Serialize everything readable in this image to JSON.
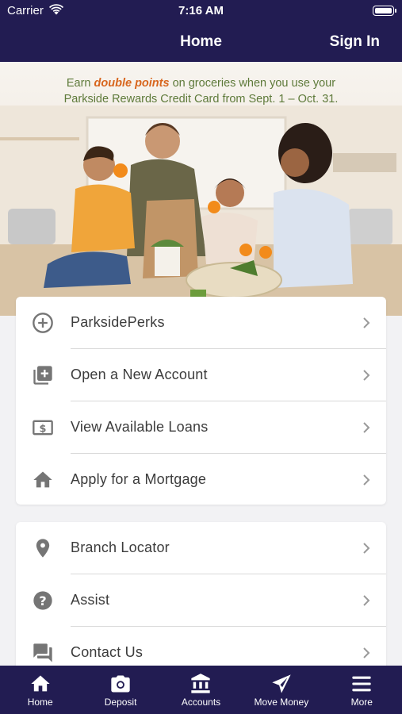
{
  "status_bar": {
    "carrier": "Carrier",
    "time": "7:16 AM"
  },
  "nav": {
    "title": "Home",
    "sign_in": "Sign In"
  },
  "banner": {
    "line1_pre": "Earn ",
    "line1_highlight": "double points",
    "line1_post": " on groceries when you use your",
    "line2": "Parkside Rewards Credit Card from Sept. 1 – Oct. 31."
  },
  "menu_primary": [
    {
      "label": "ParksidePerks",
      "icon": "plus-circle-icon"
    },
    {
      "label": "Open a New Account",
      "icon": "add-box-icon"
    },
    {
      "label": "View Available Loans",
      "icon": "dollar-bill-icon"
    },
    {
      "label": "Apply for a Mortgage",
      "icon": "home-icon"
    }
  ],
  "menu_secondary": [
    {
      "label": "Branch Locator",
      "icon": "location-pin-icon"
    },
    {
      "label": "Assist",
      "icon": "help-icon"
    },
    {
      "label": "Contact Us",
      "icon": "chat-icon"
    }
  ],
  "tabs": [
    {
      "label": "Home",
      "icon": "home-icon"
    },
    {
      "label": "Deposit",
      "icon": "camera-icon"
    },
    {
      "label": "Accounts",
      "icon": "bank-icon"
    },
    {
      "label": "Move Money",
      "icon": "send-icon"
    },
    {
      "label": "More",
      "icon": "menu-icon"
    }
  ],
  "colors": {
    "brand": "#221c52",
    "banner_text": "#5e7a3a",
    "banner_highlight": "#d8661e",
    "icon": "#757575"
  }
}
